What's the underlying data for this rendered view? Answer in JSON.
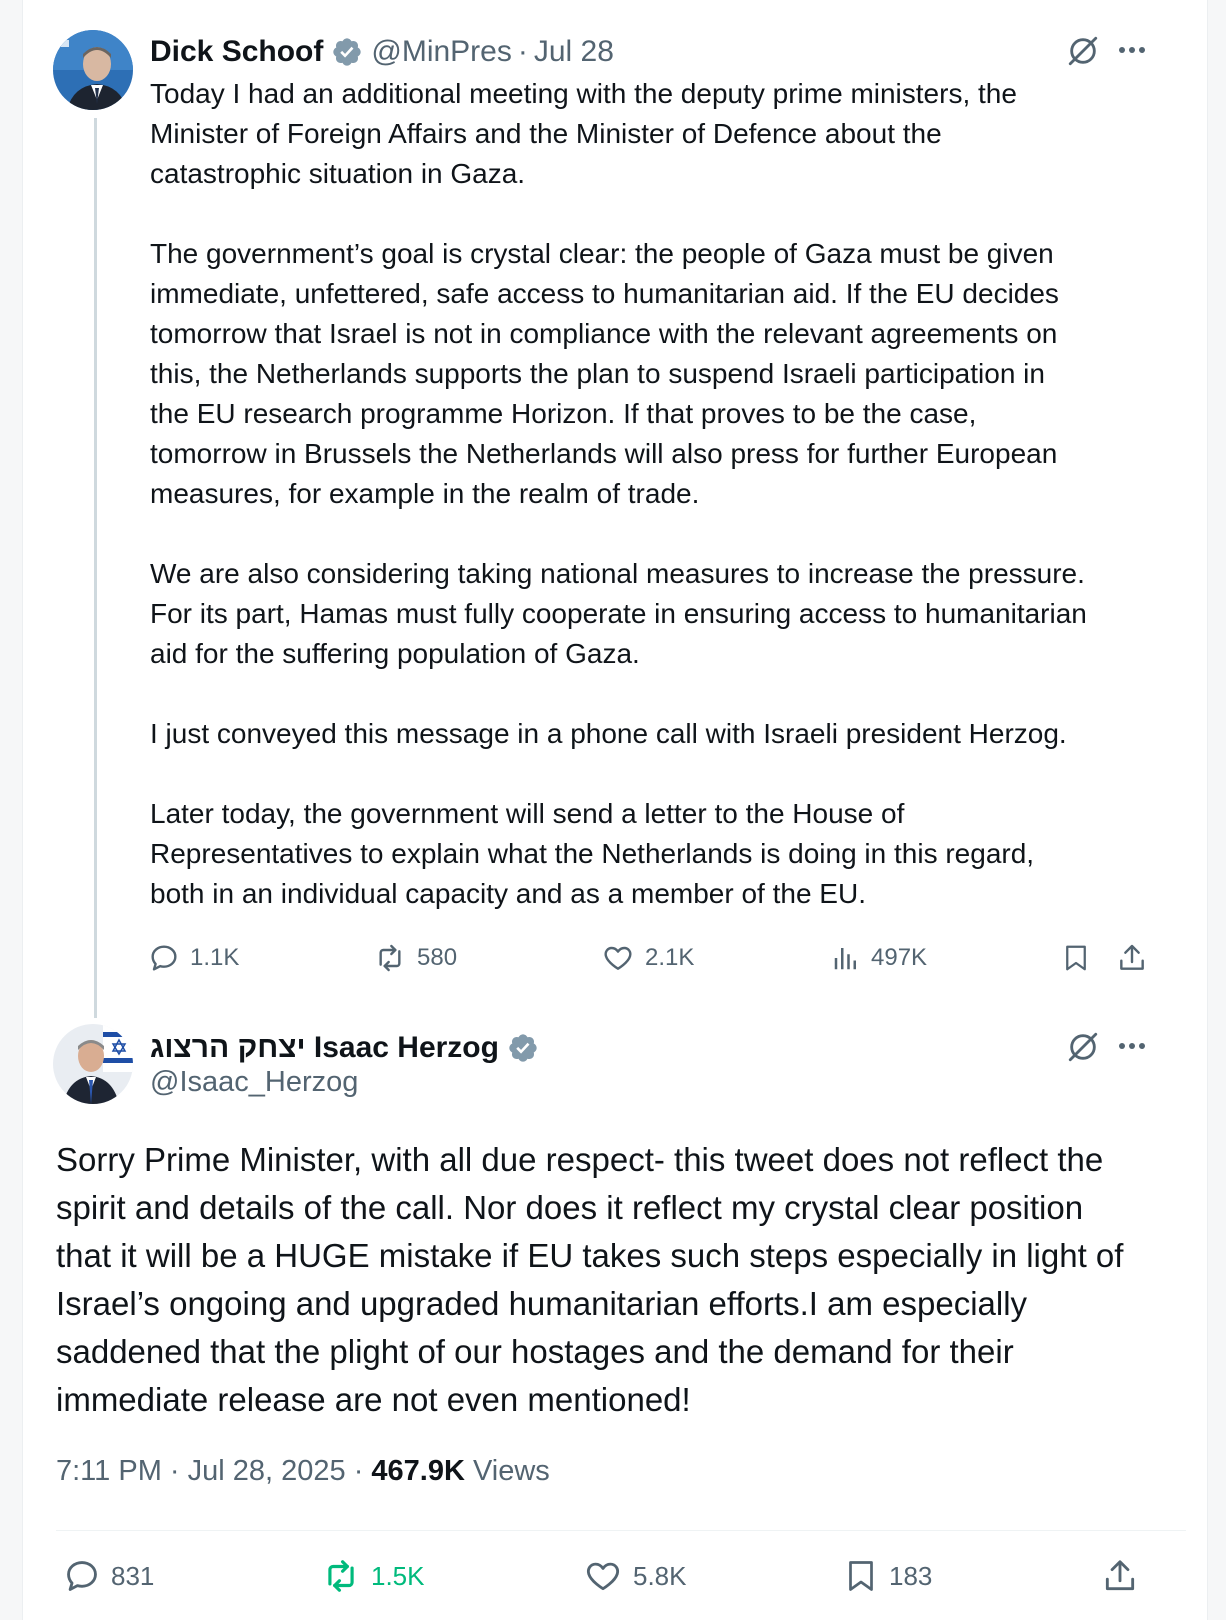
{
  "parent_tweet": {
    "display_name": "Dick Schoof",
    "handle": "@MinPres",
    "separator": "·",
    "date": "Jul 28",
    "paragraphs": [
      [
        "Today I had an additional meeting with the deputy prime ministers, the",
        "Minister of Foreign Affairs and the Minister of Defence about the",
        "catastrophic situation in Gaza."
      ],
      [
        "The government’s goal is crystal clear: the people of Gaza must be given",
        "immediate, unfettered, safe access to humanitarian aid. If the EU decides",
        "tomorrow that Israel is not in compliance with the relevant agreements on",
        "this, the Netherlands supports the plan to suspend Israeli participation in",
        "the EU research programme Horizon. If that proves to be the case,",
        "tomorrow in Brussels the Netherlands will also press for further European",
        "measures, for example in the realm of trade."
      ],
      [
        "We are also considering taking national measures to increase the pressure.",
        "For its part, Hamas must fully cooperate in ensuring access to humanitarian",
        "aid for the suffering population of Gaza."
      ],
      [
        "I just conveyed this message in a phone call with Israeli president Herzog."
      ],
      [
        "Later today, the government will send a letter to the House of",
        "Representatives to explain what the Netherlands is doing in this regard,",
        "both in an individual capacity and as a member of the EU."
      ]
    ],
    "stats": {
      "replies": "1.1K",
      "reposts": "580",
      "likes": "2.1K",
      "views": "497K"
    }
  },
  "reply_tweet": {
    "display_name": "יצחק הרצוג Isaac Herzog",
    "handle": "@Isaac_Herzog",
    "body_lines": [
      "Sorry Prime Minister, with all due respect- this tweet does not reflect the",
      "spirit and details of the call. Nor does it reflect my crystal clear position",
      "that it will be a HUGE mistake if EU takes such steps especially in light of",
      "Israel’s ongoing and upgraded humanitarian efforts.I am especially",
      "saddened that the plight of our hostages and the demand for their",
      "immediate release are not even mentioned!"
    ],
    "timestamp": "7:11 PM · Jul 28, 2025 · ",
    "views_count": "467.9K",
    "views_label": " Views",
    "stats": {
      "replies": "831",
      "reposts": "1.5K",
      "likes": "5.8K",
      "bookmarks": "183"
    }
  },
  "icons": {
    "verified": "verified-badge-icon",
    "grok": "grok-icon",
    "more": "more-icon",
    "reply": "reply-icon",
    "repost": "repost-icon",
    "like": "like-icon",
    "views": "views-icon",
    "bookmark": "bookmark-icon",
    "share": "share-icon"
  },
  "colors": {
    "text": "#0f1419",
    "secondary": "#536471",
    "verified": "#829aab",
    "repost_active": "#00ba7c",
    "thread_line": "#cfd9de"
  }
}
